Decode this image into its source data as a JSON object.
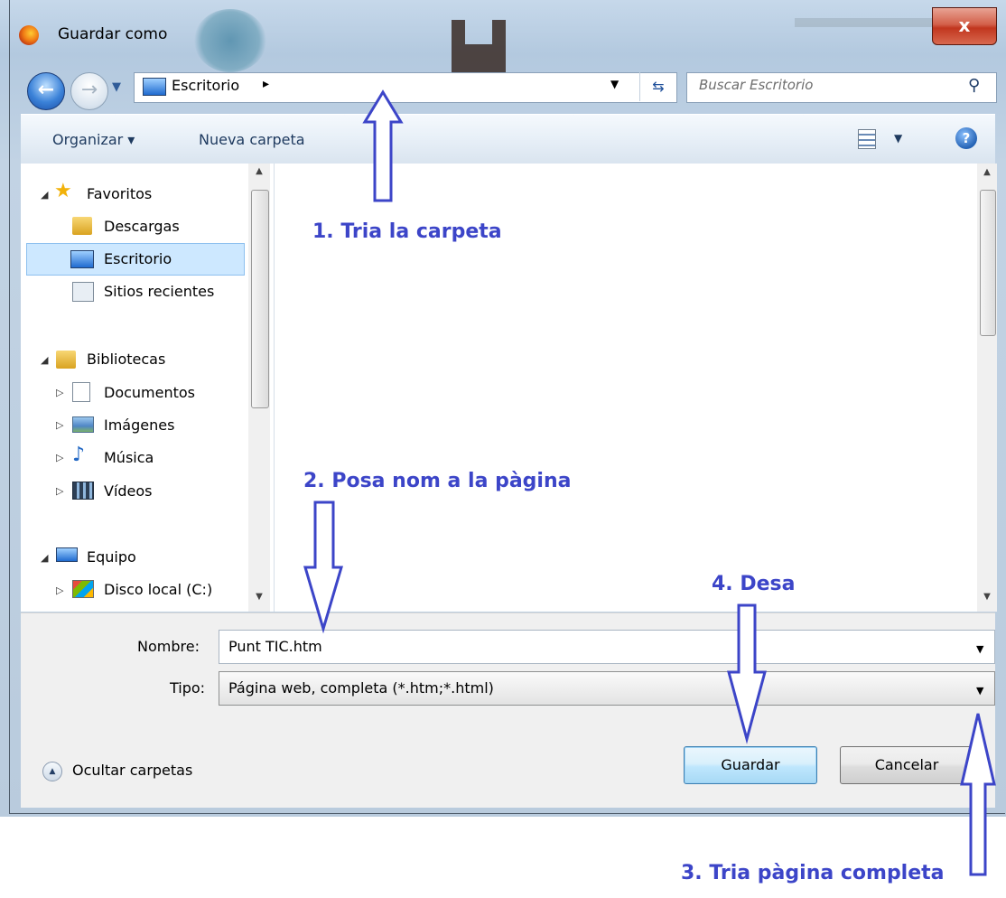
{
  "window": {
    "title": "Guardar como",
    "close_label": "x"
  },
  "nav": {
    "back_icon": "back-arrow-icon",
    "forward_icon": "forward-arrow-icon",
    "address": "Escritorio",
    "address_chevron": "▸",
    "search_placeholder": "Buscar Escritorio"
  },
  "toolbar": {
    "organize": "Organizar ▾",
    "new_folder": "Nueva carpeta",
    "help": "?"
  },
  "tree": {
    "favorites": "Favoritos",
    "downloads": "Descargas",
    "desktop": "Escritorio",
    "recent": "Sitios recientes",
    "libraries": "Bibliotecas",
    "documents": "Documentos",
    "images": "Imágenes",
    "music": "Música",
    "videos": "Vídeos",
    "computer": "Equipo",
    "local_disk": "Disco local (C:)"
  },
  "form": {
    "name_label": "Nombre:",
    "name_value": "Punt TIC.htm",
    "type_label": "Tipo:",
    "type_value": "Página web, completa (*.htm;*.html)"
  },
  "buttons": {
    "hide_folders": "Ocultar carpetas",
    "save": "Guardar",
    "cancel": "Cancelar"
  },
  "annotations": {
    "step1": "1. Tria la carpeta",
    "step2": "2. Posa nom a la pàgina",
    "step3": "3. Tria pàgina completa",
    "step4": "4. Desa"
  },
  "colors": {
    "annotation": "#3c45c8",
    "selection": "#cde8ff",
    "close": "#c1361e"
  }
}
